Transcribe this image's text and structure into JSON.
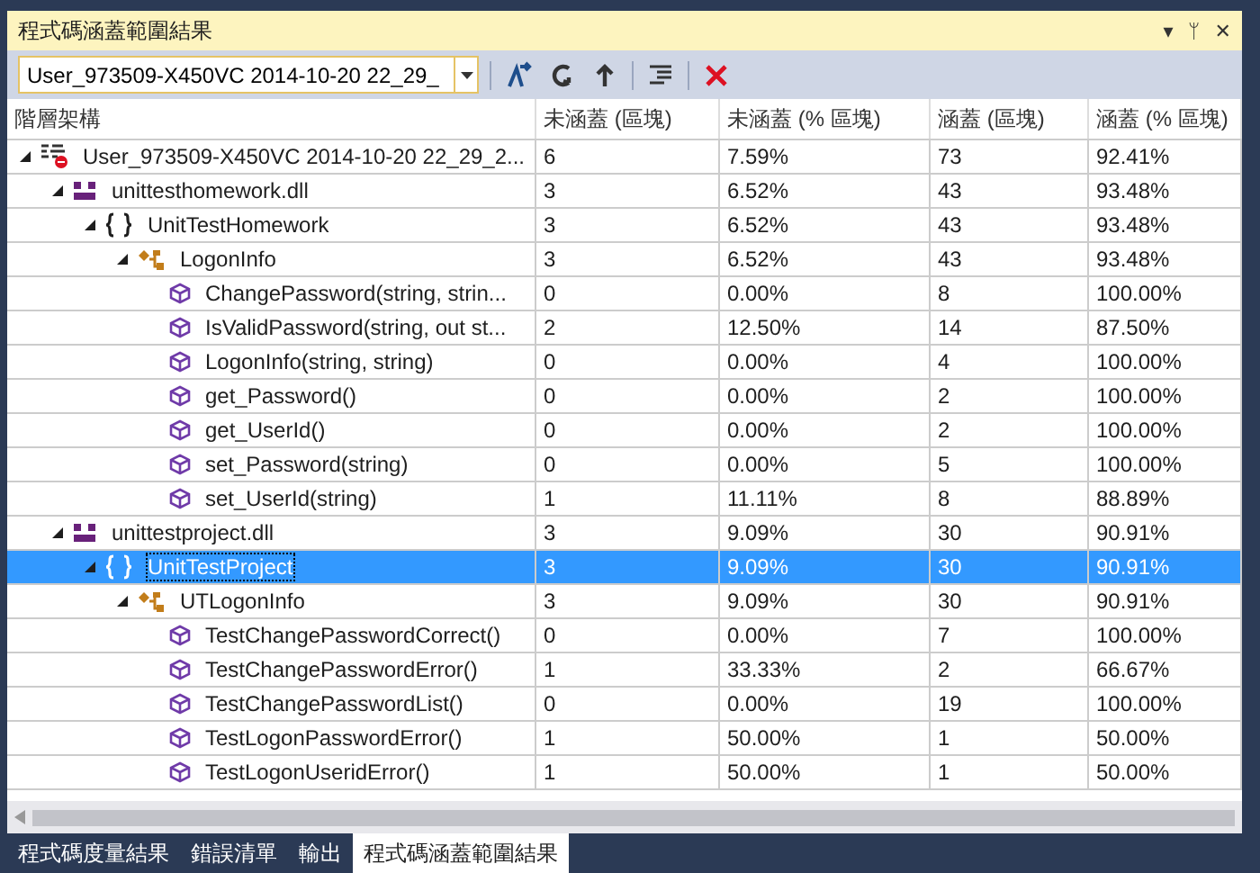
{
  "panel": {
    "title": "程式碼涵蓋範圍結果",
    "caption_buttons": [
      "▾",
      "ᛘ",
      "✕"
    ]
  },
  "toolbar": {
    "session": "User_973509-X450VC 2014-10-20 22_29_"
  },
  "table": {
    "columns": [
      "階層架構",
      "未涵蓋 (區塊)",
      "未涵蓋 (% 區塊)",
      "涵蓋 (區塊)",
      "涵蓋 (% 區塊)"
    ],
    "rows": [
      {
        "kind": "session",
        "cells": [
          "User_973509-X450VC 2014-10-20 22_29_2...",
          "6",
          "7.59%",
          "73",
          "92.41%"
        ],
        "expanded": true,
        "selected": false,
        "children": [
          {
            "kind": "assembly",
            "cells": [
              "unittesthomework.dll",
              "3",
              "6.52%",
              "43",
              "93.48%"
            ],
            "expanded": true,
            "selected": false,
            "children": [
              {
                "kind": "namespace",
                "cells": [
                  "UnitTestHomework",
                  "3",
                  "6.52%",
                  "43",
                  "93.48%"
                ],
                "expanded": true,
                "selected": false,
                "children": [
                  {
                    "kind": "class",
                    "cells": [
                      "LogonInfo",
                      "3",
                      "6.52%",
                      "43",
                      "93.48%"
                    ],
                    "expanded": true,
                    "selected": false,
                    "children": [
                      {
                        "kind": "method",
                        "cells": [
                          "ChangePassword(string, strin...",
                          "0",
                          "0.00%",
                          "8",
                          "100.00%"
                        ],
                        "selected": false
                      },
                      {
                        "kind": "method",
                        "cells": [
                          "IsValidPassword(string, out st...",
                          "2",
                          "12.50%",
                          "14",
                          "87.50%"
                        ],
                        "selected": false
                      },
                      {
                        "kind": "method",
                        "cells": [
                          "LogonInfo(string, string)",
                          "0",
                          "0.00%",
                          "4",
                          "100.00%"
                        ],
                        "selected": false
                      },
                      {
                        "kind": "method",
                        "cells": [
                          "get_Password()",
                          "0",
                          "0.00%",
                          "2",
                          "100.00%"
                        ],
                        "selected": false
                      },
                      {
                        "kind": "method",
                        "cells": [
                          "get_UserId()",
                          "0",
                          "0.00%",
                          "2",
                          "100.00%"
                        ],
                        "selected": false
                      },
                      {
                        "kind": "method",
                        "cells": [
                          "set_Password(string)",
                          "0",
                          "0.00%",
                          "5",
                          "100.00%"
                        ],
                        "selected": false
                      },
                      {
                        "kind": "method",
                        "cells": [
                          "set_UserId(string)",
                          "1",
                          "11.11%",
                          "8",
                          "88.89%"
                        ],
                        "selected": false
                      }
                    ]
                  }
                ]
              }
            ]
          },
          {
            "kind": "assembly",
            "cells": [
              "unittestproject.dll",
              "3",
              "9.09%",
              "30",
              "90.91%"
            ],
            "expanded": true,
            "selected": false,
            "children": [
              {
                "kind": "namespace",
                "cells": [
                  "UnitTestProject",
                  "3",
                  "9.09%",
                  "30",
                  "90.91%"
                ],
                "expanded": true,
                "selected": true,
                "children": [
                  {
                    "kind": "class",
                    "cells": [
                      "UTLogonInfo",
                      "3",
                      "9.09%",
                      "30",
                      "90.91%"
                    ],
                    "expanded": true,
                    "selected": false,
                    "children": [
                      {
                        "kind": "method",
                        "cells": [
                          "TestChangePasswordCorrect()",
                          "0",
                          "0.00%",
                          "7",
                          "100.00%"
                        ],
                        "selected": false
                      },
                      {
                        "kind": "method",
                        "cells": [
                          "TestChangePasswordError()",
                          "1",
                          "33.33%",
                          "2",
                          "66.67%"
                        ],
                        "selected": false
                      },
                      {
                        "kind": "method",
                        "cells": [
                          "TestChangePasswordList()",
                          "0",
                          "0.00%",
                          "19",
                          "100.00%"
                        ],
                        "selected": false
                      },
                      {
                        "kind": "method",
                        "cells": [
                          "TestLogonPasswordError()",
                          "1",
                          "50.00%",
                          "1",
                          "50.00%"
                        ],
                        "selected": false
                      },
                      {
                        "kind": "method",
                        "cells": [
                          "TestLogonUseridError()",
                          "1",
                          "50.00%",
                          "1",
                          "50.00%"
                        ],
                        "selected": false
                      }
                    ]
                  }
                ]
              }
            ]
          }
        ]
      }
    ]
  },
  "bottom_tabs": [
    {
      "label": "程式碼度量結果",
      "selected": false
    },
    {
      "label": "錯誤清單",
      "selected": false
    },
    {
      "label": "輸出",
      "selected": false
    },
    {
      "label": "程式碼涵蓋範圍結果",
      "selected": true
    }
  ]
}
